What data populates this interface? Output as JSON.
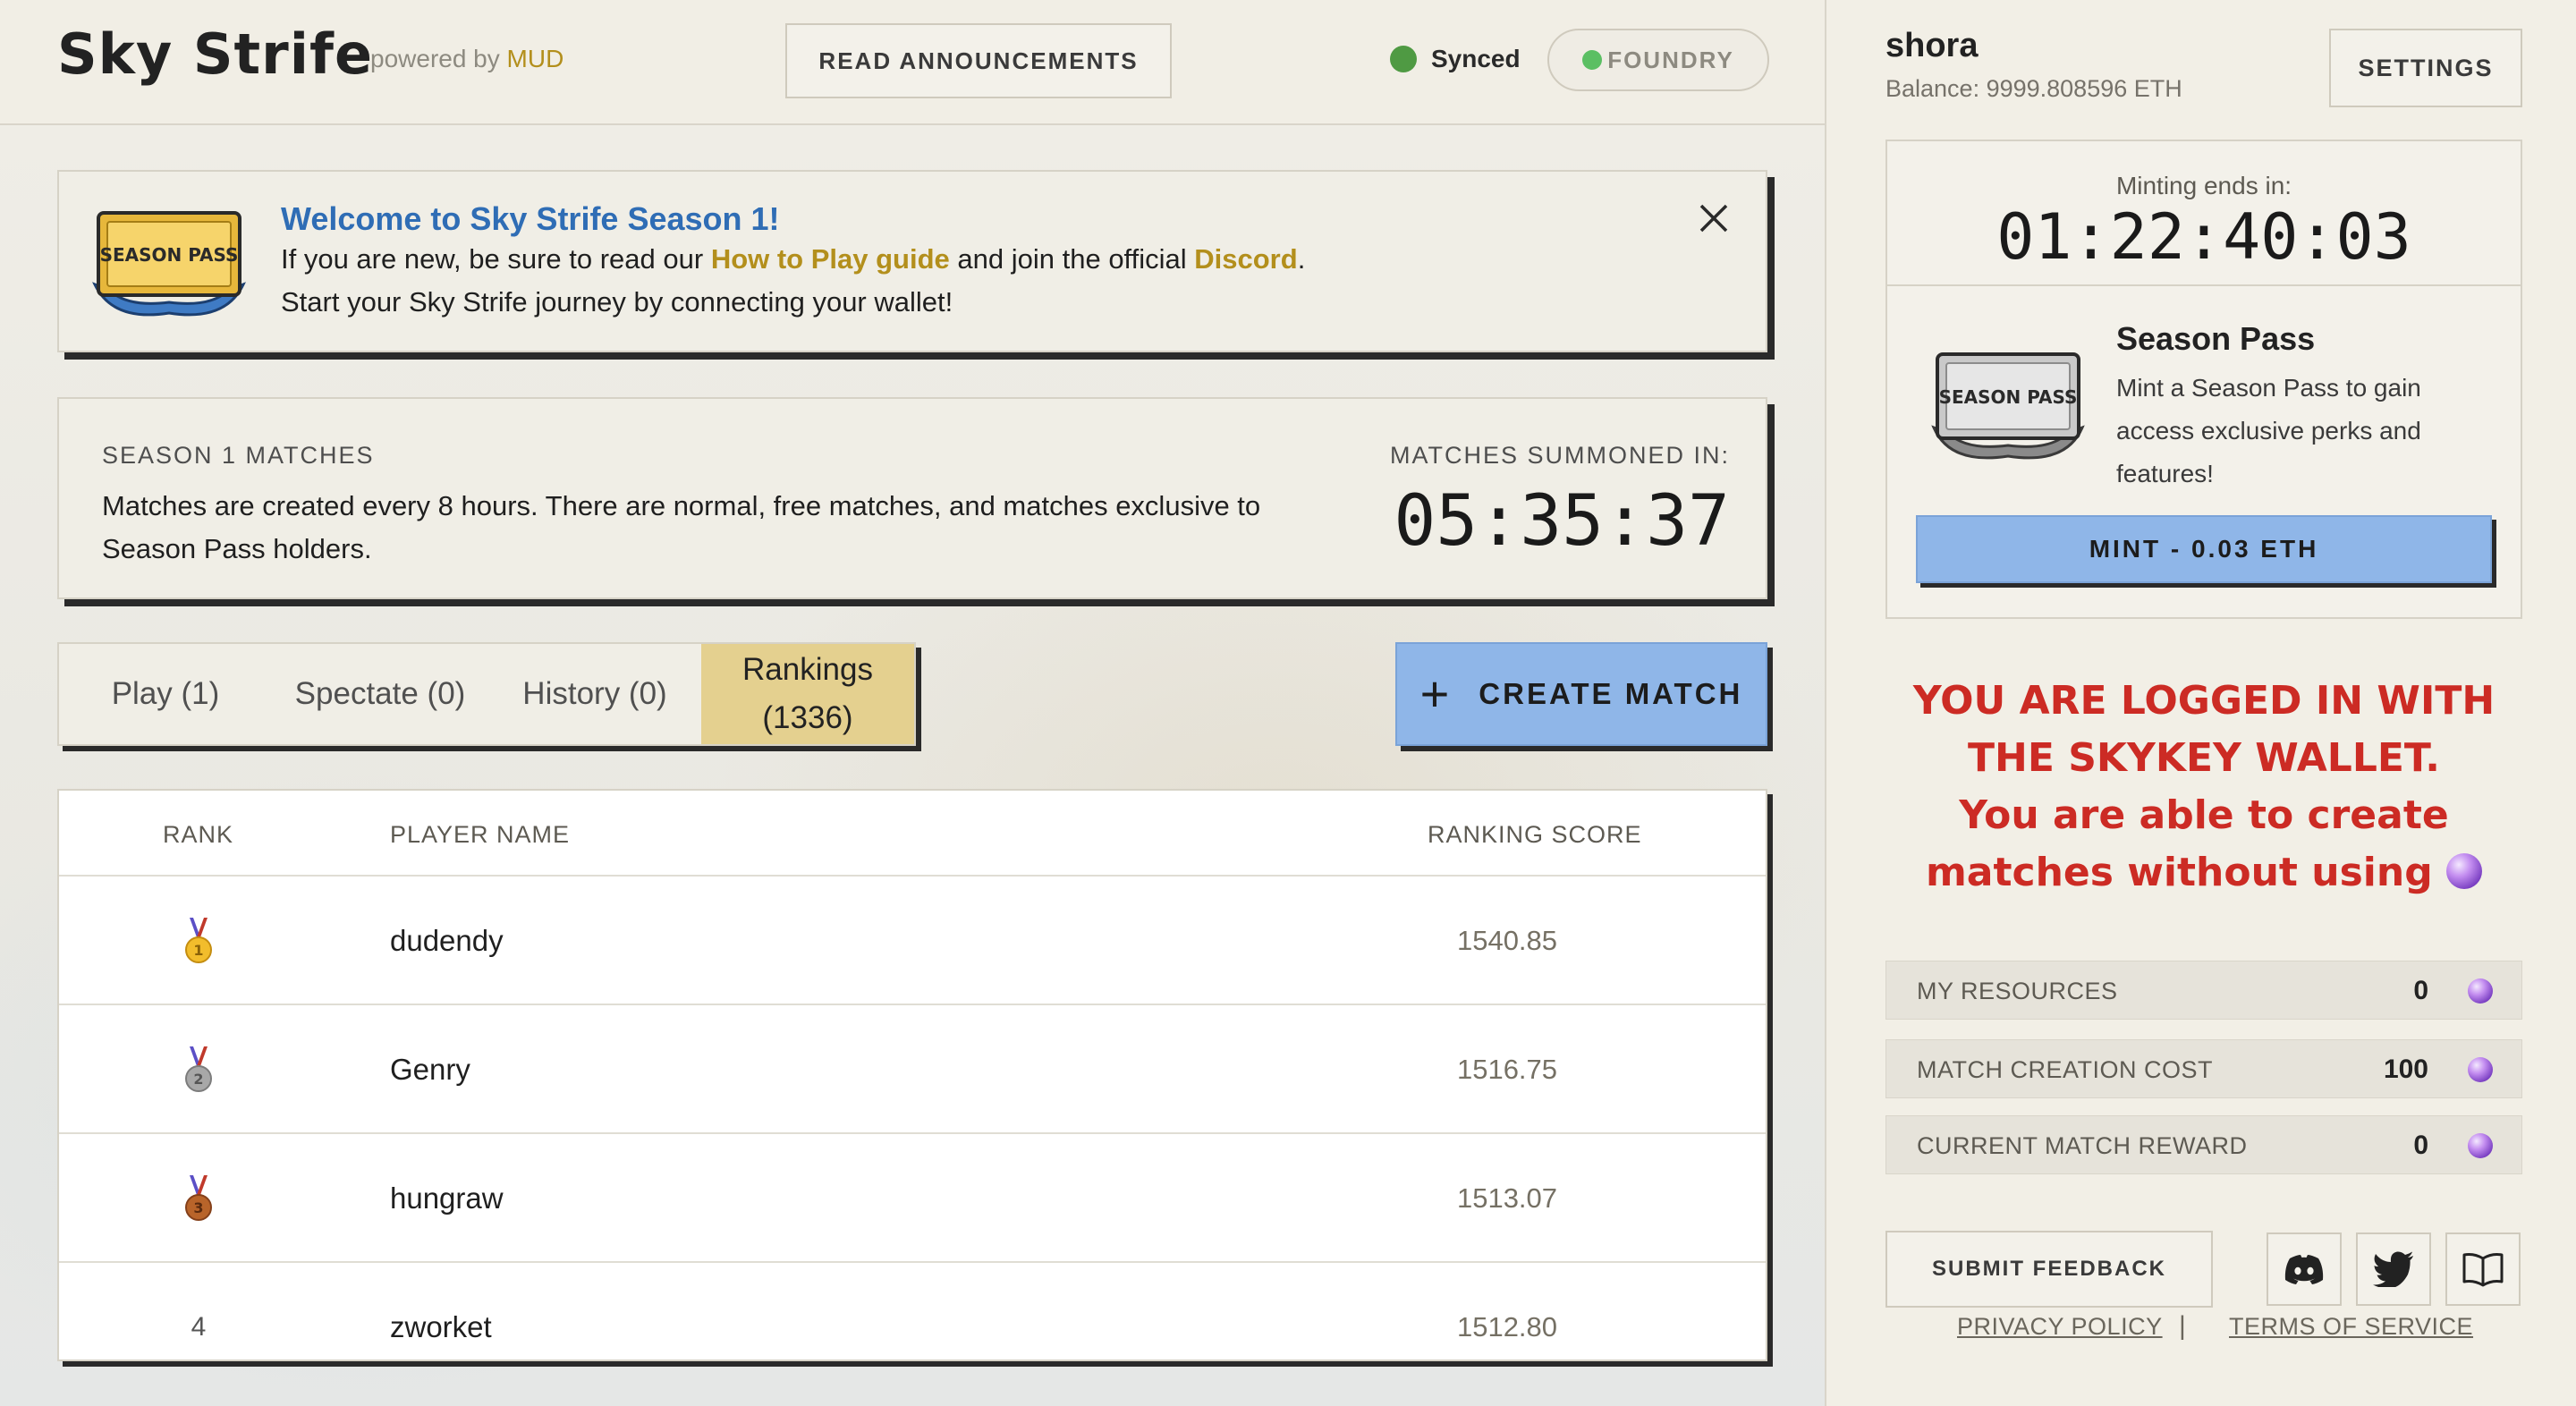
{
  "header": {
    "brand": "Sky Strife",
    "powered_prefix": "powered by",
    "powered_brand": "MUD",
    "read_announcements": "READ ANNOUNCEMENTS",
    "sync_status": "Synced",
    "foundry": "FOUNDRY"
  },
  "welcome": {
    "art_text": "SEASON PASS",
    "title": "Welcome to Sky Strife Season 1!",
    "line1_a": "If you are new, be sure to read our",
    "line1_link": "How to Play guide",
    "line1_b": "and join the official",
    "line1_discord": "Discord",
    "line1_end": ".",
    "line2": "Start your Sky Strife journey by connecting your wallet!"
  },
  "season_matches": {
    "label": "SEASON 1 MATCHES",
    "description": "Matches are created every 8 hours. There are normal, free matches, and matches exclusive to Season Pass holders.",
    "summoned_label": "MATCHES SUMMONED IN:",
    "summoned_timer": "05:35:37"
  },
  "tabs": [
    {
      "label": "Play (1)"
    },
    {
      "label": "Spectate (0)"
    },
    {
      "label": "History (0)"
    },
    {
      "label_line1": "Rankings",
      "label_line2": "(1336)"
    }
  ],
  "create_match": "CREATE MATCH",
  "rankings": {
    "columns": [
      "RANK",
      "PLAYER NAME",
      "RANKING SCORE"
    ],
    "rows": [
      {
        "rank": "1",
        "name": "dudendy",
        "score": "1540.85"
      },
      {
        "rank": "2",
        "name": "Genry",
        "score": "1516.75"
      },
      {
        "rank": "3",
        "name": "hungraw",
        "score": "1513.07"
      },
      {
        "rank": "4",
        "name": "zworket",
        "score": "1512.80"
      }
    ]
  },
  "sidebar": {
    "username": "shora",
    "balance": "Balance: 9999.808596 ETH",
    "settings": "SETTINGS",
    "minting_label": "Minting ends in:",
    "minting_timer": "01:22:40:03",
    "pass_art_text": "SEASON PASS",
    "season_pass_title": "Season Pass",
    "season_pass_desc": "Mint a Season Pass to gain access exclusive perks and features!",
    "mint_button": "MINT - 0.03 ETH",
    "warning_line1": "YOU ARE LOGGED IN WITH",
    "warning_line2": "THE SKYKEY WALLET.",
    "warning_line3": "You are able to create",
    "warning_line4": "matches without using",
    "resources": [
      {
        "label": "MY RESOURCES",
        "value": "0"
      },
      {
        "label": "MATCH CREATION COST",
        "value": "100"
      },
      {
        "label": "CURRENT MATCH REWARD",
        "value": "0"
      }
    ],
    "submit_feedback": "SUBMIT FEEDBACK",
    "privacy": "PRIVACY POLICY",
    "separator": "|",
    "terms": "TERMS OF SERVICE"
  },
  "colors": {
    "accent_blue": "#8fb6e8",
    "gold": "#b38f1c",
    "warning_red": "#cc2b24",
    "title_blue": "#2f6db5",
    "tab_active": "#e4d08f"
  },
  "icons": [
    "close-icon",
    "plus-icon",
    "gold-medal-icon",
    "silver-medal-icon",
    "bronze-medal-icon",
    "orb-icon",
    "discord-icon",
    "twitter-icon",
    "book-icon"
  ]
}
